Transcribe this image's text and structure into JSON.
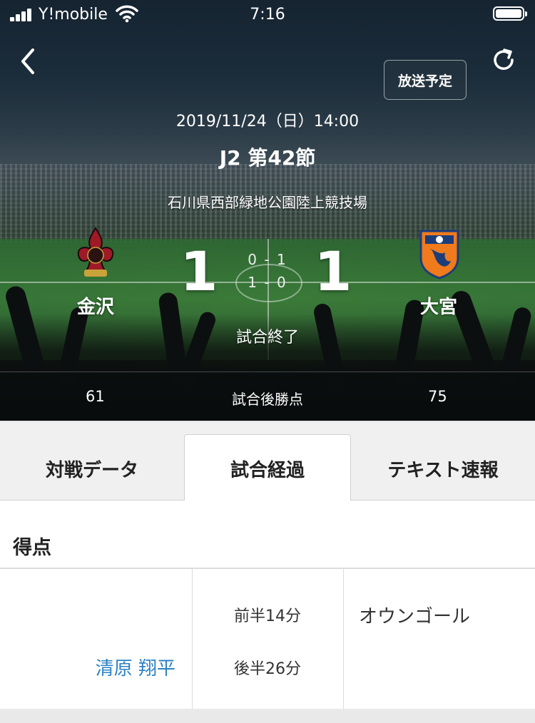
{
  "status_bar": {
    "carrier": "Y!mobile",
    "time": "7:16"
  },
  "header": {
    "broadcast_label": "放送予定"
  },
  "match": {
    "datetime": "2019/11/24（日）14:00",
    "round": "J2 第42節",
    "venue": "石川県西部緑地公園陸上競技場",
    "status": "試合終了",
    "home": {
      "name": "金沢",
      "score": "1",
      "points": "61",
      "color": "#a11a25"
    },
    "away": {
      "name": "大宮",
      "score": "1",
      "points": "75",
      "color": "#f07a1c"
    },
    "first_half": "0 - 1",
    "second_half": "1 - 0",
    "points_label": "試合後勝点"
  },
  "tabs": [
    {
      "label": "対戦データ",
      "active": false
    },
    {
      "label": "試合経過",
      "active": true
    },
    {
      "label": "テキスト速報",
      "active": false
    }
  ],
  "goals_section": {
    "title": "得点",
    "rows": [
      {
        "home_scorer": "",
        "time": "前半14分",
        "away_scorer": "オウンゴール"
      },
      {
        "home_scorer": "清原 翔平",
        "time": "後半26分",
        "away_scorer": ""
      }
    ]
  },
  "colors": {
    "link": "#2b82c5",
    "tab_bg": "#f0f0f0"
  }
}
